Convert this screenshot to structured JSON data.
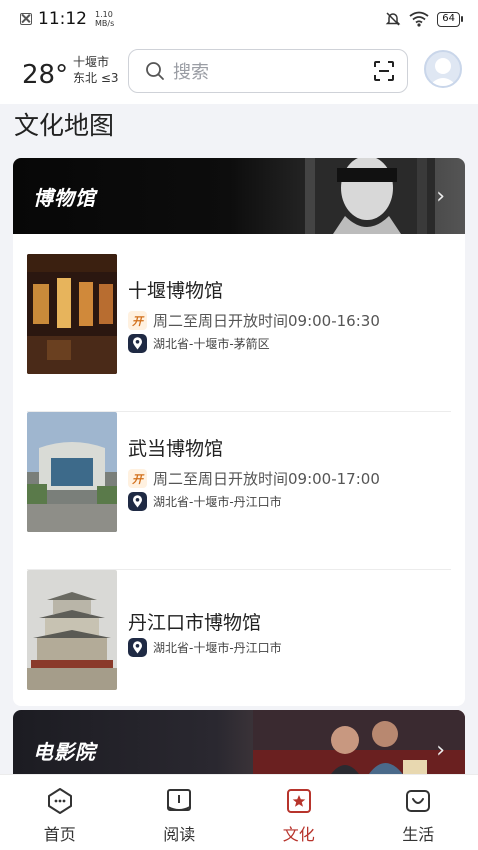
{
  "status_bar": {
    "time": "11:12",
    "speed_value": "1.10",
    "speed_unit": "MB/s",
    "battery": "64"
  },
  "header": {
    "temperature": "28°",
    "city": "十堰市",
    "wind": "东北 ≤3",
    "search_placeholder": "搜索"
  },
  "page_title": "文化地图",
  "museum_section": {
    "title": "博物馆",
    "items": [
      {
        "name": "十堰博物馆",
        "hours": "周二至周日开放时间09:00-16:30",
        "address": "湖北省-十堰市-茅箭区"
      },
      {
        "name": "武当博物馆",
        "hours": "周二至周日开放时间09:00-17:00",
        "address": "湖北省-十堰市-丹江口市"
      },
      {
        "name": "丹江口市博物馆",
        "address": "湖北省-十堰市-丹江口市"
      }
    ]
  },
  "cinema_section": {
    "title": "电影院"
  },
  "bottom_nav": [
    {
      "label": "首页",
      "icon": "home-icon"
    },
    {
      "label": "阅读",
      "icon": "book-icon"
    },
    {
      "label": "文化",
      "icon": "culture-icon",
      "active": true
    },
    {
      "label": "生活",
      "icon": "life-icon"
    }
  ],
  "colors": {
    "accent": "#b7342c",
    "open_badge": "#d2701c",
    "pin_badge": "#1f2a44"
  }
}
